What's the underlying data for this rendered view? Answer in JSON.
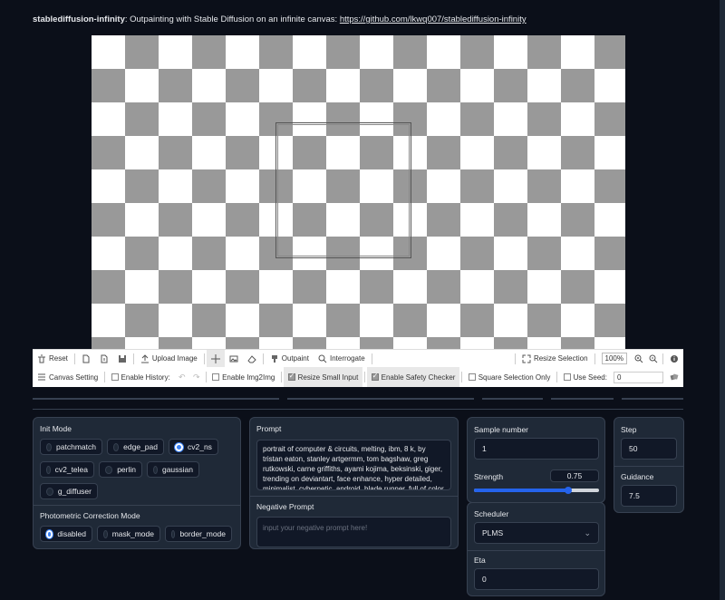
{
  "header": {
    "app_name": "stablediffusion-infinity",
    "description": ": Outpainting with Stable Diffusion on an infinite canvas: ",
    "link_text": "https://github.com/lkwq007/stablediffusion-infinity"
  },
  "toolbar1": {
    "reset": "Reset",
    "upload_image": "Upload Image",
    "outpaint": "Outpaint",
    "interrogate": "Interrogate",
    "resize_selection": "Resize Selection",
    "zoom": "100%"
  },
  "toolbar2": {
    "canvas_setting": "Canvas Setting",
    "enable_history": "Enable History:",
    "enable_img2img": "Enable Img2Img",
    "resize_small_input": "Resize Small Input",
    "enable_safety_checker": "Enable Safety Checker",
    "square_selection_only": "Square Selection Only",
    "use_seed": "Use Seed:",
    "seed_value": "0"
  },
  "init_mode": {
    "title": "Init Mode",
    "options": [
      "patchmatch",
      "edge_pad",
      "cv2_ns",
      "cv2_telea",
      "perlin",
      "gaussian",
      "g_diffuser"
    ],
    "selected": "cv2_ns"
  },
  "photometric": {
    "title": "Photometric Correction Mode",
    "options": [
      "disabled",
      "mask_mode",
      "border_mode"
    ],
    "selected": "disabled"
  },
  "prompt": {
    "title": "Prompt",
    "value": "portrait of computer & circuits, melting, ibm, 8 k, by tristan eaton, stanley artgermm, tom bagshaw, greg rutkowski, carne griffiths, ayami kojima, beksinski, giger, trending on deviantart, face enhance, hyper detailed, minimalist, cybernetic, android, blade runner, full of color"
  },
  "negative_prompt": {
    "title": "Negative Prompt",
    "placeholder": "input your negative prompt here!"
  },
  "sample_number": {
    "title": "Sample number",
    "value": "1"
  },
  "strength": {
    "title": "Strength",
    "value": "0.75",
    "fraction": 0.75
  },
  "scheduler": {
    "title": "Scheduler",
    "value": "PLMS"
  },
  "eta": {
    "title": "Eta",
    "value": "0"
  },
  "step": {
    "title": "Step",
    "value": "50"
  },
  "guidance": {
    "title": "Guidance",
    "value": "7.5"
  }
}
